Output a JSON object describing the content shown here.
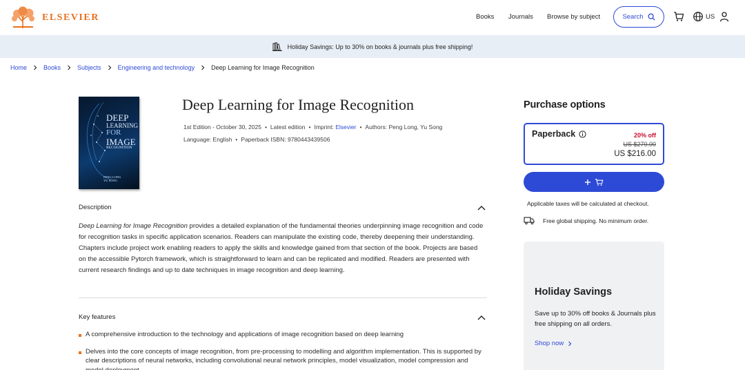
{
  "header": {
    "logo_text": "ELSEVIER",
    "nav": [
      "Books",
      "Journals",
      "Browse by subject"
    ],
    "search_label": "Search",
    "region": "US",
    "icons": [
      "search-icon",
      "cart-icon",
      "globe-icon",
      "user-icon"
    ]
  },
  "banner": {
    "text": "Holiday Savings: Up to 30% on books & journals plus free shipping!",
    "icon": "books-icon"
  },
  "breadcrumb": {
    "items": [
      "Home",
      "Books",
      "Subjects",
      "Engineering and technology"
    ],
    "current": "Deep Learning for Image Recognition"
  },
  "cover": {
    "title_lines": [
      "DEEP",
      "LEARNING",
      "FOR",
      "IMAGE",
      "RECOGNITION"
    ],
    "authors": [
      "PENG LONG",
      "YU SONG"
    ]
  },
  "book": {
    "title": "Deep Learning for Image Recognition",
    "edition": "1st Edition - October 30, 2025",
    "status": "Latest edition",
    "imprint_label": "Imprint:",
    "imprint": "Elsevier",
    "authors": "Authors: Peng Long, Yu Song",
    "language": "Language: English",
    "isbn": "Paperback ISBN: 9780443439506"
  },
  "description": {
    "heading": "Description",
    "title_italic": "Deep Learning for Image Recognition",
    "body": " provides a detailed explanation of the fundamental theories underpinning image recognition and code for recognition tasks in specific application scenarios. Readers can manipulate the existing code, thereby deepening their understanding. Chapters include project work enabling readers to apply the skills and knowledge gained from that section of the book. Projects are based on the accessible Pytorch framework, which is straightforward to learn and can be replicated and modified. Readers are presented with current research findings and up to date techniques in image recognition and deep learning."
  },
  "key_features": {
    "heading": "Key features",
    "items": [
      "A comprehensive introduction to the technology and applications of image recognition based on deep learning",
      "Delves into the core concepts of image recognition, from pre-processing to modelling and algorithm implementation. This is supported by clear descriptions of neural networks, including convolutional neural network principles, model visualization, model compression and model deployment"
    ]
  },
  "purchase": {
    "title": "Purchase options",
    "option_name": "Paperback",
    "discount": "20% off",
    "old_price": "US $270.00",
    "price": "US $216.00",
    "tax_note": "Applicable taxes will be calculated at checkout.",
    "shipping": "Free global shipping. No minimum order."
  },
  "promo": {
    "title": "Holiday Savings",
    "text": "Save up to 30% off books & Journals plus free shipping on all orders.",
    "link": "Shop now"
  },
  "colors": {
    "brand_orange": "#e9711c",
    "link_blue": "#2d4ad6",
    "discount_red": "#c4102e",
    "banner_bg": "#e8eef6"
  }
}
